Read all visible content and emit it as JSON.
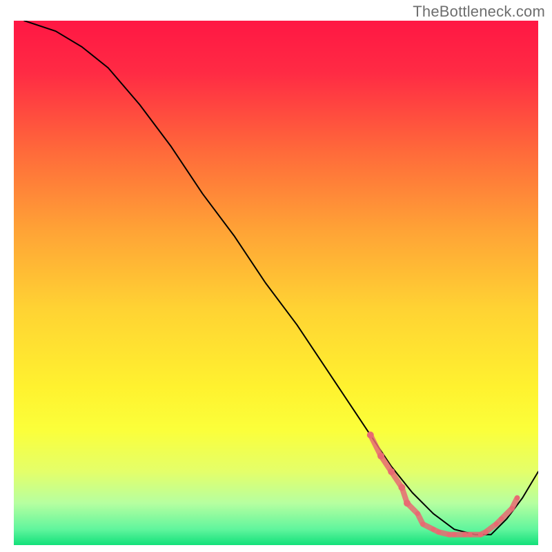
{
  "watermark": "TheBottleneck.com",
  "chart_data": {
    "type": "line",
    "title": "",
    "xlabel": "",
    "ylabel": "",
    "xlim": [
      0,
      100
    ],
    "ylim": [
      0,
      100
    ],
    "gradient": {
      "stops": [
        {
          "offset": 0.0,
          "color": "#ff1744"
        },
        {
          "offset": 0.1,
          "color": "#ff2b44"
        },
        {
          "offset": 0.25,
          "color": "#ff6a3a"
        },
        {
          "offset": 0.4,
          "color": "#ffa336"
        },
        {
          "offset": 0.55,
          "color": "#ffd333"
        },
        {
          "offset": 0.7,
          "color": "#fff22f"
        },
        {
          "offset": 0.78,
          "color": "#fbff3a"
        },
        {
          "offset": 0.86,
          "color": "#e4ff6a"
        },
        {
          "offset": 0.92,
          "color": "#b6ffa0"
        },
        {
          "offset": 0.97,
          "color": "#60f59d"
        },
        {
          "offset": 1.0,
          "color": "#12e07a"
        }
      ]
    },
    "series": [
      {
        "name": "curve",
        "x": [
          2,
          8,
          13,
          18,
          24,
          30,
          36,
          42,
          48,
          54,
          60,
          64,
          68,
          72,
          76,
          80,
          84,
          88,
          91,
          94,
          97,
          100
        ],
        "values": [
          100,
          98,
          95,
          91,
          84,
          76,
          67,
          59,
          50,
          42,
          33,
          27,
          21,
          15,
          10,
          6,
          3,
          2,
          2,
          5,
          9,
          14
        ],
        "color": "#000000",
        "width": 2
      }
    ],
    "markers": {
      "name": "optimal-band",
      "color": "#e86a72",
      "radius_small": 3.5,
      "radius_big": 5,
      "points": [
        {
          "x": 68,
          "y": 21,
          "size": "big"
        },
        {
          "x": 70,
          "y": 17,
          "size": "big"
        },
        {
          "x": 72,
          "y": 14,
          "size": "big"
        },
        {
          "x": 74,
          "y": 11,
          "size": "big"
        },
        {
          "x": 75,
          "y": 8,
          "size": "big"
        },
        {
          "x": 77,
          "y": 6,
          "size": "small"
        },
        {
          "x": 78,
          "y": 4,
          "size": "small"
        },
        {
          "x": 80,
          "y": 3,
          "size": "small"
        },
        {
          "x": 81,
          "y": 2.5,
          "size": "small"
        },
        {
          "x": 83,
          "y": 2,
          "size": "small"
        },
        {
          "x": 84,
          "y": 2,
          "size": "small"
        },
        {
          "x": 86,
          "y": 2,
          "size": "small"
        },
        {
          "x": 87,
          "y": 2,
          "size": "small"
        },
        {
          "x": 89,
          "y": 2,
          "size": "small"
        },
        {
          "x": 90,
          "y": 2.5,
          "size": "small"
        },
        {
          "x": 92,
          "y": 4,
          "size": "small"
        },
        {
          "x": 93,
          "y": 5,
          "size": "small"
        },
        {
          "x": 95,
          "y": 7,
          "size": "small"
        },
        {
          "x": 96,
          "y": 9,
          "size": "small"
        }
      ]
    }
  }
}
